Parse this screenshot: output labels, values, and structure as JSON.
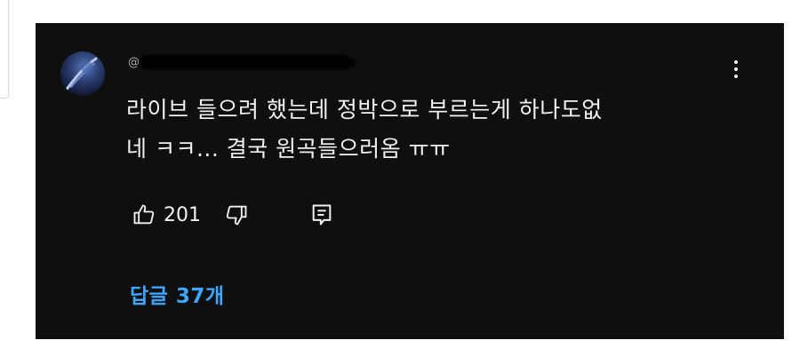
{
  "comment": {
    "author": "@",
    "text": "라이브 들으려 했는데 정박으로 부르는게 하나도없\n네 ㅋㅋ... 결국 원곡들으러옴 ㅠㅠ",
    "likes": "201",
    "replies_label": "답글 37개"
  },
  "icons": {
    "avatar": "avatar-image",
    "more": "more-vert-icon",
    "like": "thumbs-up-icon",
    "dislike": "thumbs-down-icon",
    "reply": "reply-icon"
  },
  "colors": {
    "background": "#0f0f0f",
    "text": "#f1f1f1",
    "link": "#3ea6ff"
  }
}
